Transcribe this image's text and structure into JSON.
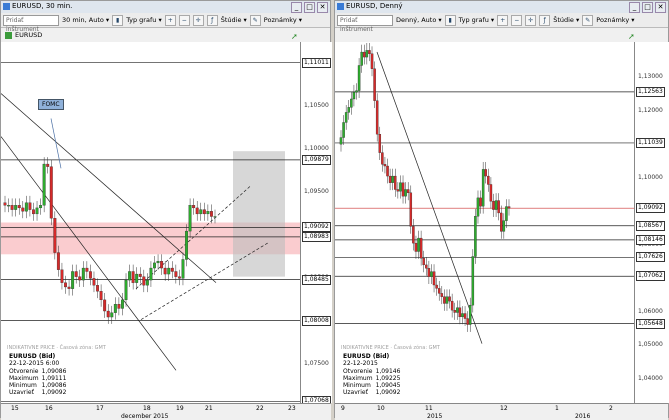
{
  "left": {
    "window_title": "EURUSD, 30 min.",
    "instrument_placeholder": "Pridať inštrument",
    "interval": "30 min,",
    "scale": "Auto",
    "chart_type": "Typ grafu",
    "studies": "Štúdie",
    "notes": "Poznámky",
    "legend": "EURUSD",
    "price_labels": [
      "1,10500",
      "1,10000",
      "1,09500",
      "1,09000",
      "1,08500",
      "1,08000",
      "1,07500",
      "1,07000"
    ],
    "boxed_prices": [
      "1,11011",
      "1,09879",
      "1,09092",
      "1,08983",
      "1,08485",
      "1,08008",
      "1,07068"
    ],
    "x_labels": [
      "15",
      "16",
      "17",
      "18",
      "19",
      "21",
      "22",
      "23"
    ],
    "x_month": "december 2015",
    "annotation": "FOMC",
    "source_note": "INDIKATIVNE PRICE · Časová zóna: GMT",
    "info": {
      "title": "EURUSD (Bid)",
      "date": "22-12-2015 6:00",
      "rows": [
        [
          "Otvorenie",
          "1,09086"
        ],
        [
          "Maximum",
          "1,09111"
        ],
        [
          "Minimum",
          "1,09086"
        ],
        [
          "Uzavrieť",
          "1,09092"
        ]
      ]
    }
  },
  "right": {
    "window_title": "EURUSD, Denný",
    "instrument_placeholder": "Pridať inštrument",
    "interval": "Denný,",
    "scale": "Auto",
    "chart_type": "Typ grafu",
    "studies": "Štúdie",
    "notes": "Poznámky",
    "price_labels": [
      "1,13000",
      "1,12000",
      "1,11000",
      "1,10000",
      "1,09000",
      "1,08000",
      "1,07000",
      "1,06000",
      "1,05000",
      "1,04000"
    ],
    "boxed_prices": [
      "1,12563",
      "1,11039",
      "1,09092",
      "1,08567",
      "1,08146",
      "1,07626",
      "1,07062",
      "1,05648"
    ],
    "x_labels": [
      "9",
      "10",
      "11",
      "12",
      "1",
      "2"
    ],
    "x_years": [
      "2015",
      "2016"
    ],
    "source_note": "INDIKATIVNE PRICE · Časová zóna: GMT",
    "info": {
      "title": "EURUSD (Bid)",
      "date": "22-12-2015",
      "rows": [
        [
          "Otvorenie",
          "1,09146"
        ],
        [
          "Maximum",
          "1,09225"
        ],
        [
          "Minimum",
          "1,09045"
        ],
        [
          "Uzavrieť",
          "1,09092"
        ]
      ]
    }
  },
  "colors": {
    "up": "#2eaa2e",
    "down": "#d42a2a",
    "band": "#f5a3a8",
    "shade": "#bdbdbd"
  }
}
